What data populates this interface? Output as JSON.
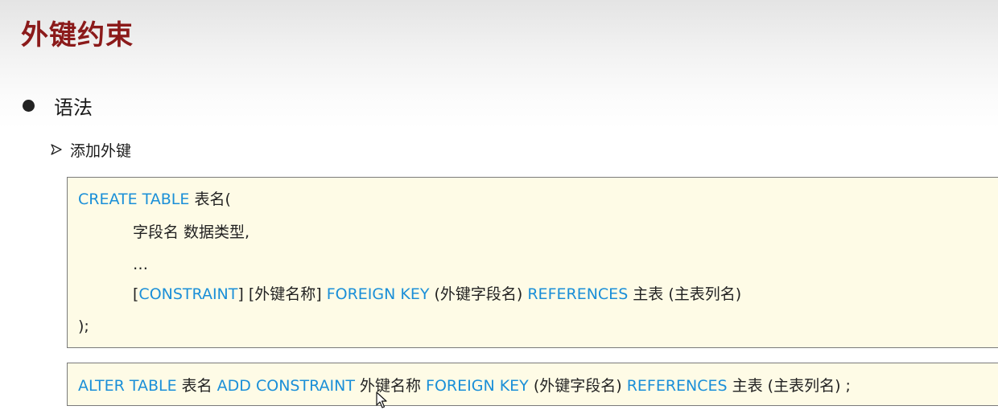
{
  "slide": {
    "title": "外键约束",
    "bullet": "语法",
    "subheading": "添加外键"
  },
  "code_block_1": {
    "line1": {
      "kw1": "CREATE TABLE",
      "t1": " 表名("
    },
    "line2": {
      "t1": "字段名    数据类型,"
    },
    "line3": {
      "t1": "…"
    },
    "line4": {
      "t1": "[",
      "kw1": "CONSTRAINT",
      "t2": "]   [外键名称]  ",
      "kw2": "FOREIGN  KEY",
      "t3": " (外键字段名)   ",
      "kw3": "REFERENCES",
      "t4": "   主表 (主表列名)"
    },
    "line5": {
      "t1": ");"
    }
  },
  "code_block_2": {
    "line1": {
      "kw1": "ALTER   TABLE",
      "t1": "  表名   ",
      "kw2": "ADD  CONSTRAINT",
      "t2": "   外键名称   ",
      "kw3": "FOREIGN   KEY",
      "t3": " (外键字段名)  ",
      "kw4": "REFERENCES",
      "t4": "  主表 (主表列名) ;"
    }
  },
  "colors": {
    "title": "#8b1a1a",
    "keyword": "#1a8fd8",
    "code_background": "#fefbe6",
    "code_border": "#7a7a7a"
  },
  "icons": {
    "bullet": "filled-circle-icon",
    "sub_bullet": "arrowhead-icon",
    "cursor": "mouse-pointer-icon"
  }
}
